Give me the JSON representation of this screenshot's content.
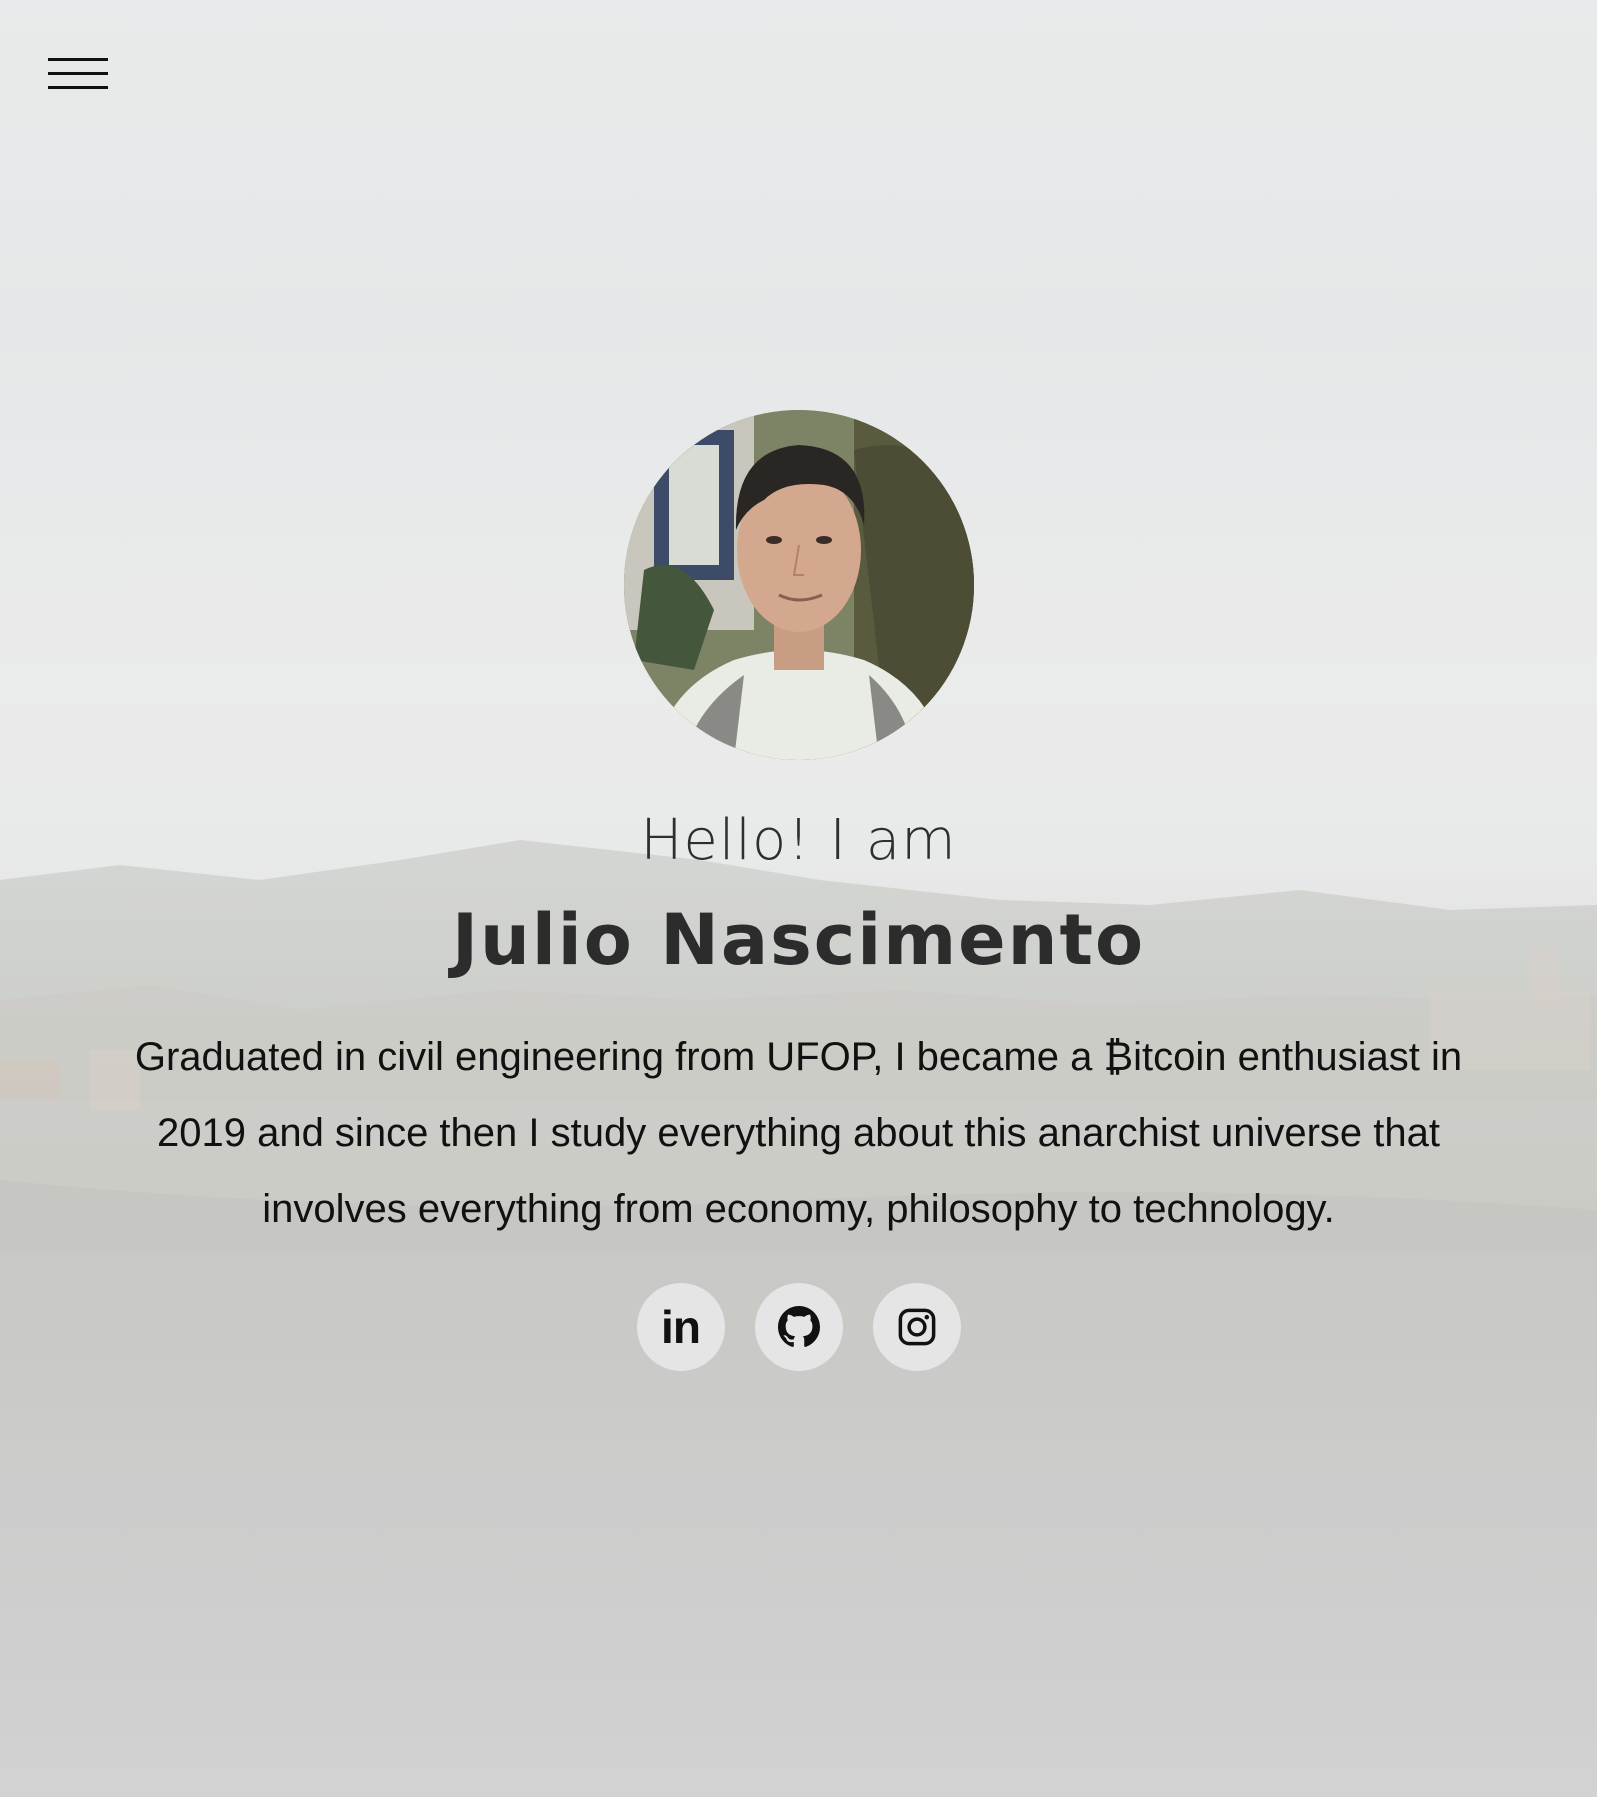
{
  "nav": {
    "menu_icon": "hamburger-menu-icon"
  },
  "hero": {
    "greeting": "Hello! I am",
    "name": "Julio Nascimento",
    "bio": "Graduated in civil engineering from UFOP, I became a ₿itcoin enthusiast in 2019 and since then I study everything about this anarchist universe that involves everything from economy, philosophy to technology."
  },
  "socials": [
    {
      "icon": "linkedin-icon",
      "label": "in"
    },
    {
      "icon": "github-icon"
    },
    {
      "icon": "instagram-icon"
    }
  ],
  "colors": {
    "text_dark": "#2c2c2c",
    "social_bg": "#e8e8e8"
  }
}
